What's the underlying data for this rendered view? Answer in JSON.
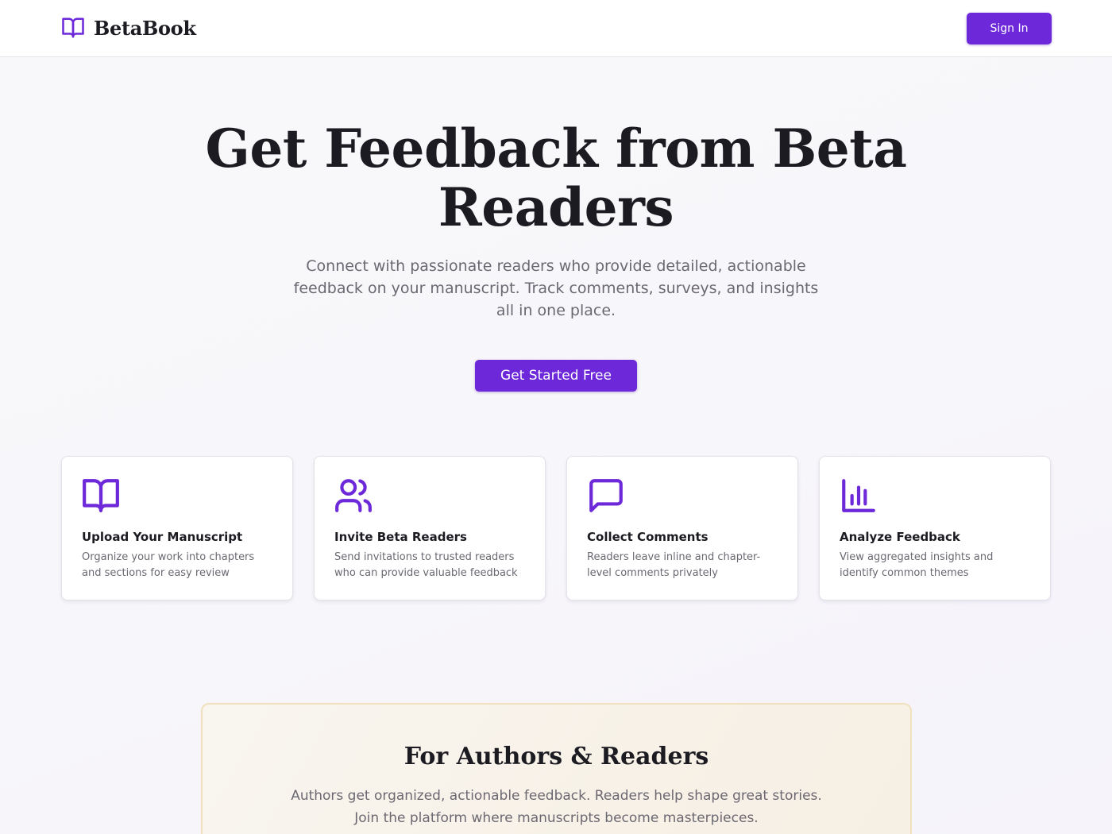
{
  "brand": {
    "name": "BetaBook",
    "accent_color": "#6d28d9",
    "logo_icon": "open-book-icon"
  },
  "header": {
    "signin_label": "Sign In"
  },
  "hero": {
    "title": "Get Feedback from Beta Readers",
    "subtitle": "Connect with passionate readers who provide detailed, actionable feedback on your manuscript. Track comments, surveys, and insights all in one place.",
    "cta_label": "Get Started Free"
  },
  "features": [
    {
      "icon": "book-icon",
      "title": "Upload Your Manuscript",
      "description": "Organize your work into chapters and sections for easy review"
    },
    {
      "icon": "users-icon",
      "title": "Invite Beta Readers",
      "description": "Send invitations to trusted readers who can provide valuable feedback"
    },
    {
      "icon": "message-square-icon",
      "title": "Collect Comments",
      "description": "Readers leave inline and chapter-level comments privately"
    },
    {
      "icon": "bar-chart-icon",
      "title": "Analyze Feedback",
      "description": "View aggregated insights and identify common themes"
    }
  ],
  "audience": {
    "title": "For Authors & Readers",
    "text": "Authors get organized, actionable feedback. Readers help shape great stories. Join the platform where manuscripts become masterpieces."
  }
}
